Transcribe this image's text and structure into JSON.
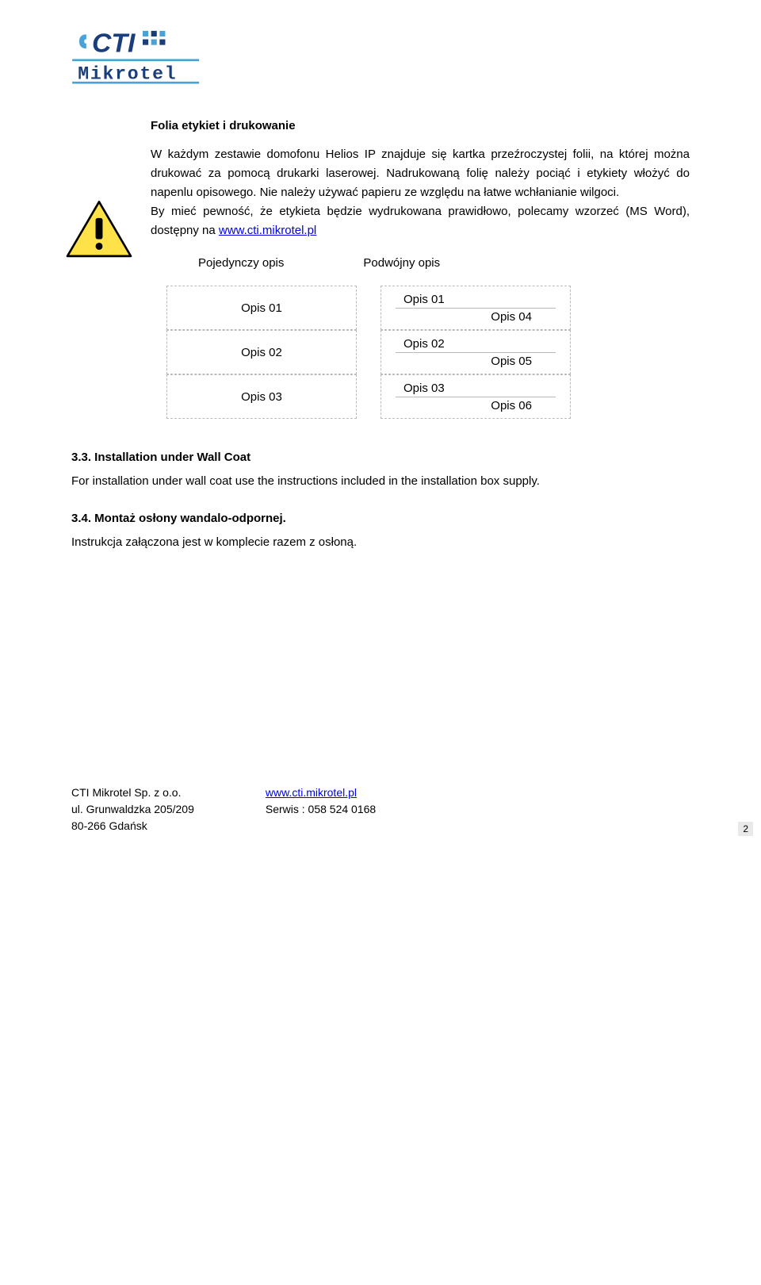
{
  "logo": {
    "name": "CTI Mikrotel logo",
    "top_text": "CTI",
    "bottom_text": "Mikrotel",
    "accent_color": "#4aa3d8",
    "text_color": "#1a3e7a"
  },
  "section": {
    "title": "Folia etykiet i drukowanie",
    "body_pre": "W każdym zestawie domofonu Helios IP znajduje się kartka przeźroczystej folii, na której można drukować za pomocą drukarki laserowej. Nadrukowaną folię należy pociąć i etykiety włożyć do napenlu opisowego. Nie należy używać papieru ze względu na łatwe wchłanianie wilgoci.\nBy mieć pewność, że etykieta będzie wydrukowana prawidłowo, polecamy wzorzeć (MS Word), dostępny na ",
    "body_link_text": "www.cti.mikrotel.pl",
    "body_link_href": "http://www.cti.mikrotel.pl"
  },
  "labels": {
    "single": "Pojedynczy opis",
    "double": "Podwójny opis"
  },
  "opis_single": [
    "Opis 01",
    "Opis 02",
    "Opis 03"
  ],
  "opis_double": [
    {
      "a": "Opis 01",
      "b": "Opis 04"
    },
    {
      "a": "Opis 02",
      "b": "Opis 05"
    },
    {
      "a": "Opis 03",
      "b": "Opis 06"
    }
  ],
  "sub1": {
    "heading": "3.3.  Installation under Wall Coat",
    "body": "For installation under wall coat use the instructions included in the installation box supply."
  },
  "sub2": {
    "heading": "3.4.  Montaż osłony wandalo-odpornej.",
    "body": "Instrukcja załączona jest w komplecie razem z osłoną."
  },
  "footer": {
    "company": "CTI Mikrotel Sp. z o.o.",
    "address1": "ul. Grunwaldzka 205/209",
    "address2": "80-266 Gdańsk",
    "link_text": "www.cti.mikrotel.pl",
    "link_href": "http://www.cti.mikrotel.pl",
    "service": "Serwis : 058 524 0168"
  },
  "page_num": "2"
}
